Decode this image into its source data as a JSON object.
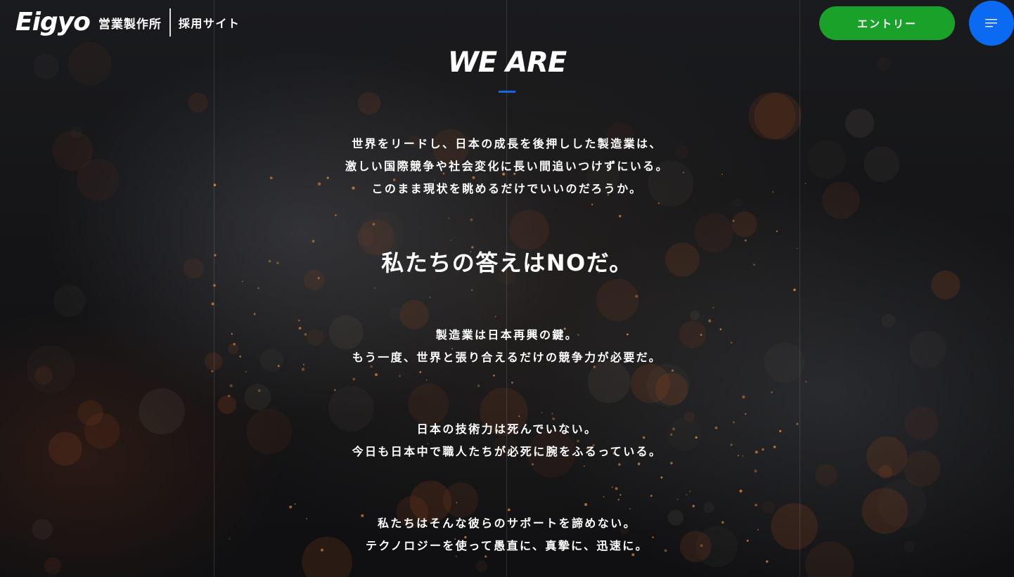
{
  "header": {
    "logo_mark": "Eigyo",
    "company_name": "営業製作所",
    "site_name": "採用サイト",
    "entry_label": "エントリー",
    "menu_icon": "hamburger-menu-icon"
  },
  "colors": {
    "entry_button": "#1aa12a",
    "menu_button": "#0a6bf2",
    "accent_underline": "#1565e6",
    "text": "#ffffff"
  },
  "section": {
    "title": "WE ARE",
    "intro_lines": [
      "世界をリードし、日本の成長を後押しした製造業は、",
      "激しい国際競争や社会変化に長い間追いつけずにいる。",
      "このまま現状を眺めるだけでいいのだろうか。"
    ],
    "headline": "私たちの答えはNOだ。",
    "para2_lines": [
      "製造業は日本再興の鍵。",
      "もう一度、世界と張り合えるだけの競争力が必要だ。"
    ],
    "para3_lines": [
      "日本の技術力は死んでいない。",
      "今日も日本中で職人たちが必死に腕をふるっている。"
    ],
    "para4_lines": [
      "私たちはそんな彼らのサポートを諦めない。",
      "テクノロジーを使って愚直に、真摯に、迅速に。"
    ]
  }
}
